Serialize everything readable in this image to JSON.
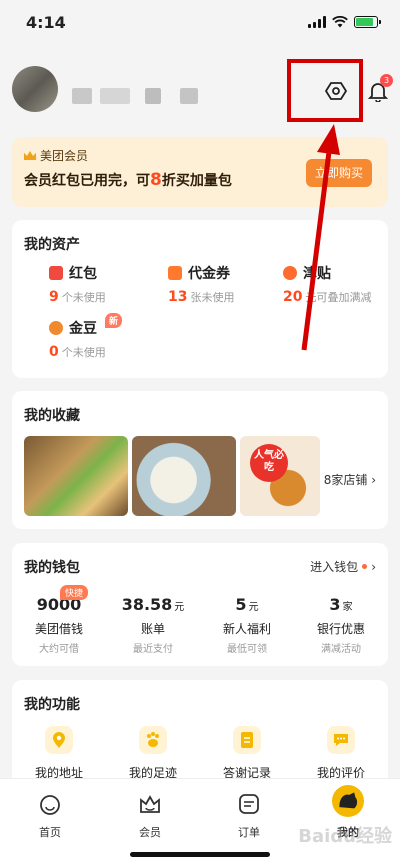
{
  "status": {
    "time": "4:14"
  },
  "notification_badge": "3",
  "vip": {
    "title": "美团会员",
    "desc_prefix": "会员红包已用完，可",
    "desc_number": "8",
    "desc_suffix": "折买加量包",
    "button": "立即购买"
  },
  "assets": {
    "title": "我的资产",
    "items": [
      {
        "name": "红包",
        "count": "9",
        "unit": "个未使用",
        "color": "#f04a3e"
      },
      {
        "name": "代金券",
        "count": "13",
        "unit": "张未使用",
        "color": "#ff7a2e"
      },
      {
        "name": "津贴",
        "count": "20",
        "unit": "元可叠加满减",
        "color": "#ff6a2e"
      },
      {
        "name": "金豆",
        "count": "0",
        "unit": "个未使用",
        "color": "#f08a2e",
        "tag": "新"
      }
    ]
  },
  "favorites": {
    "title": "我的收藏",
    "shops": "8家店铺",
    "sticker_text": "人气必吃"
  },
  "wallet": {
    "title": "我的钱包",
    "enter": "进入钱包",
    "items": [
      {
        "value": "9000",
        "unit": "",
        "label": "美团借钱",
        "sub": "大约可借",
        "tag": "快捷"
      },
      {
        "value": "38.58",
        "unit": "元",
        "label": "账单",
        "sub": "最近支付"
      },
      {
        "value": "5",
        "unit": "元",
        "label": "新人福利",
        "sub": "最低可领"
      },
      {
        "value": "3",
        "unit": "家",
        "label": "银行优惠",
        "sub": "满减活动"
      }
    ]
  },
  "functions": {
    "title": "我的功能",
    "items": [
      {
        "label": "我的地址"
      },
      {
        "label": "我的足迹"
      },
      {
        "label": "答谢记录"
      },
      {
        "label": "我的评价"
      }
    ]
  },
  "tabbar": {
    "items": [
      {
        "label": "首页"
      },
      {
        "label": "会员"
      },
      {
        "label": "订单"
      },
      {
        "label": "我的"
      }
    ]
  },
  "watermark": "Baidu经验",
  "colors": {
    "accent": "#f5b800",
    "price": "#ff4a1e",
    "highlight_box": "#d40000"
  }
}
